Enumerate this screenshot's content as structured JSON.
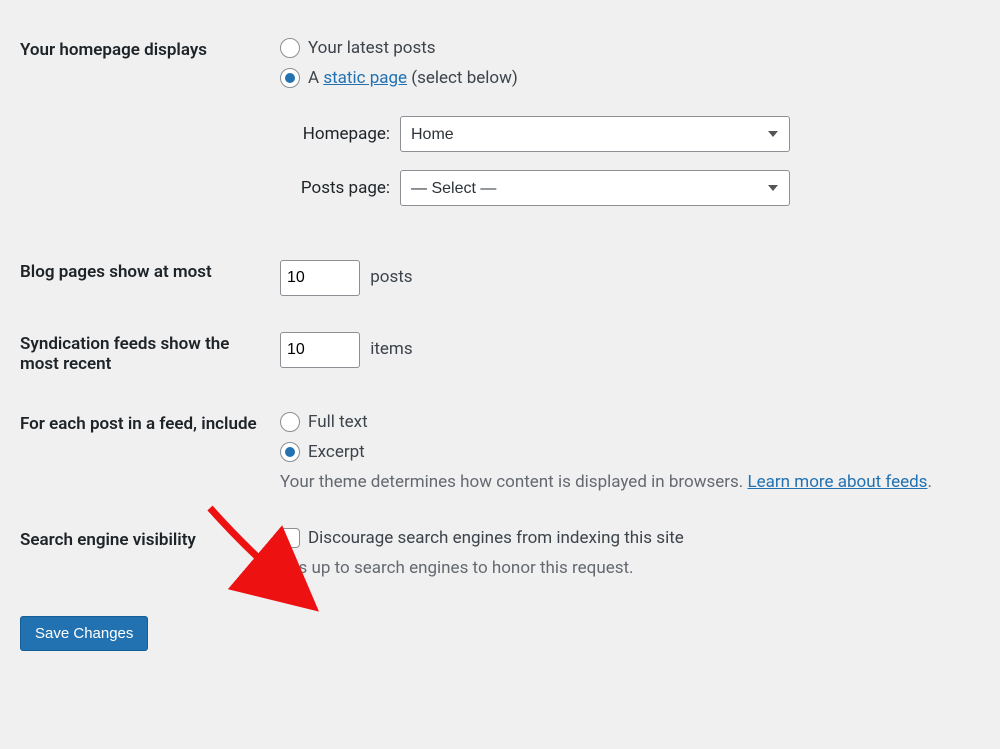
{
  "homepage": {
    "label": "Your homepage displays",
    "option_latest": "Your latest posts",
    "option_static_prefix": "A ",
    "option_static_link": "static page",
    "option_static_suffix": " (select below)",
    "homepage_label": "Homepage:",
    "homepage_value": "Home",
    "postspage_label": "Posts page:",
    "postspage_value": "— Select —"
  },
  "blog_pages": {
    "label": "Blog pages show at most",
    "value": "10",
    "unit": "posts"
  },
  "syndication": {
    "label": "Syndication feeds show the most recent",
    "value": "10",
    "unit": "items"
  },
  "feed_content": {
    "label": "For each post in a feed, include",
    "option_full": "Full text",
    "option_excerpt": "Excerpt",
    "desc_prefix": "Your theme determines how content is displayed in browsers. ",
    "desc_link": "Learn more about feeds",
    "desc_suffix": "."
  },
  "search_visibility": {
    "label": "Search engine visibility",
    "checkbox_label": "Discourage search engines from indexing this site",
    "desc": "It is up to search engines to honor this request."
  },
  "save_button": "Save Changes"
}
